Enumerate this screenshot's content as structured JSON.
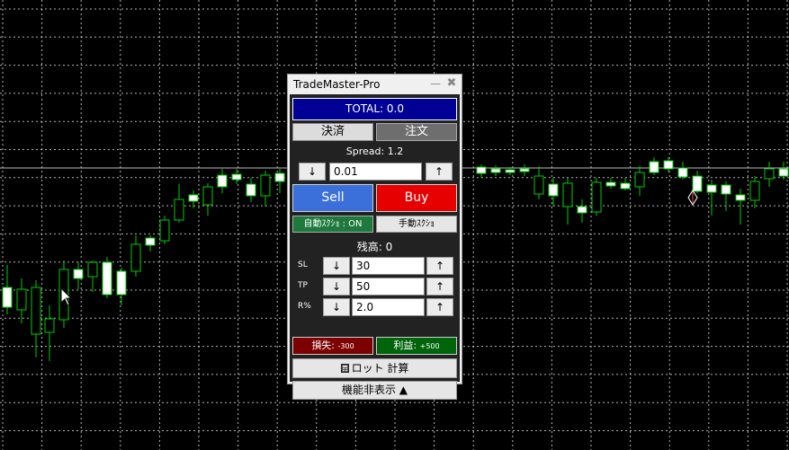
{
  "window": {
    "title": "TradeMaster-Pro",
    "min_glyph": "—",
    "close_glyph": "✖"
  },
  "panel": {
    "total_label": "TOTAL: 0.0",
    "tabs": [
      {
        "label": "決済"
      },
      {
        "label": "注文"
      }
    ],
    "spread_label": "Spread: 1.2",
    "lot": {
      "down": "↓",
      "value": "0.01",
      "up": "↑"
    },
    "sell_label": "Sell",
    "buy_label": "Buy",
    "auto_scalp_label": "自動ｽｸｼｮ : ON",
    "manual_scalp_label": "手動ｽｸｼｮ",
    "balance_label": "残高: 0",
    "sl": {
      "label": "SL",
      "down": "↓",
      "value": "30",
      "up": "↑"
    },
    "tp": {
      "label": "TP",
      "down": "↓",
      "value": "50",
      "up": "↑"
    },
    "r": {
      "label": "R%",
      "down": "↓",
      "value": "2.0",
      "up": "↑"
    },
    "loss": {
      "label": "損失:",
      "value": "-300"
    },
    "profit": {
      "label": "利益:",
      "value": "+500"
    },
    "lot_calc_label": "ロット 計算",
    "lot_calc_icon": "calculator-icon",
    "hide_label": "機能非表示 ▲"
  },
  "colors": {
    "background": "#000000",
    "grid": "#ffffff",
    "bull_candle": "#ffffff",
    "bear_candle": "#000000",
    "wick": "#00cc00",
    "total_bg": "#000096",
    "sell_bg": "#3b6fd9",
    "buy_bg": "#e60000"
  }
}
